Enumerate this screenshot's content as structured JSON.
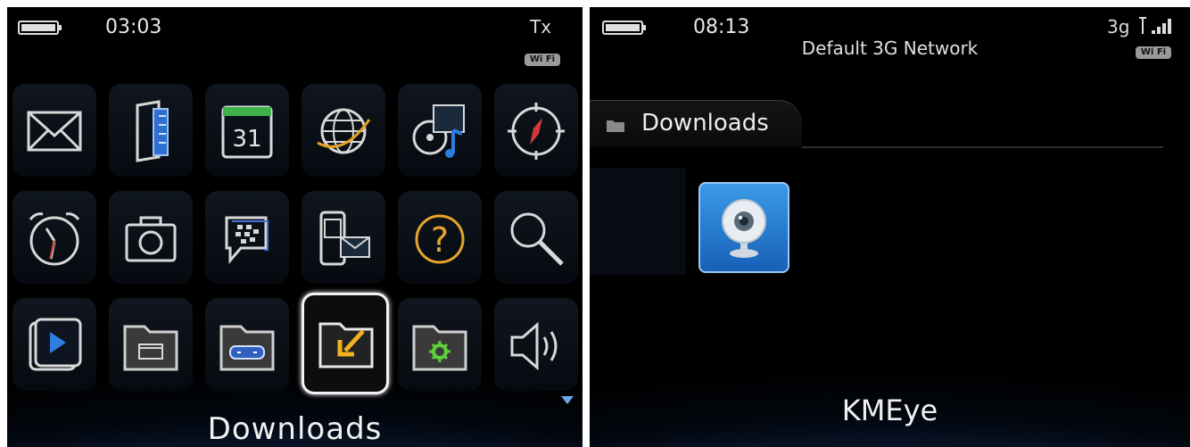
{
  "left_screen": {
    "time": "03:03",
    "signal": "Tx",
    "wifi_badge": "Wi Fi",
    "caption": "Downloads",
    "icons": [
      {
        "name": "messages-icon"
      },
      {
        "name": "contacts-icon"
      },
      {
        "name": "calendar-icon",
        "label": "31"
      },
      {
        "name": "browser-icon"
      },
      {
        "name": "media-icon"
      },
      {
        "name": "compass-icon"
      },
      {
        "name": "clock-icon"
      },
      {
        "name": "camera-icon"
      },
      {
        "name": "bbm-icon"
      },
      {
        "name": "sms-mms-icon"
      },
      {
        "name": "help-icon",
        "label": "?"
      },
      {
        "name": "search-icon"
      },
      {
        "name": "video-player-icon"
      },
      {
        "name": "applications-folder-icon"
      },
      {
        "name": "games-folder-icon"
      },
      {
        "name": "downloads-folder-icon",
        "selected": true
      },
      {
        "name": "settings-folder-icon"
      },
      {
        "name": "sound-profile-icon"
      }
    ]
  },
  "right_screen": {
    "time": "08:13",
    "signal": "3g",
    "wifi_badge": "Wi Fi",
    "network_title": "Default 3G Network",
    "folder_tab_label": "Downloads",
    "app_icon": "webcam-icon",
    "app_caption": "KMEye"
  },
  "colors": {
    "selection_border": "#f2f2f2",
    "accent_blue": "#2a76c9",
    "folder_arrow": "#f0b020",
    "settings_gear": "#5fd03a"
  }
}
